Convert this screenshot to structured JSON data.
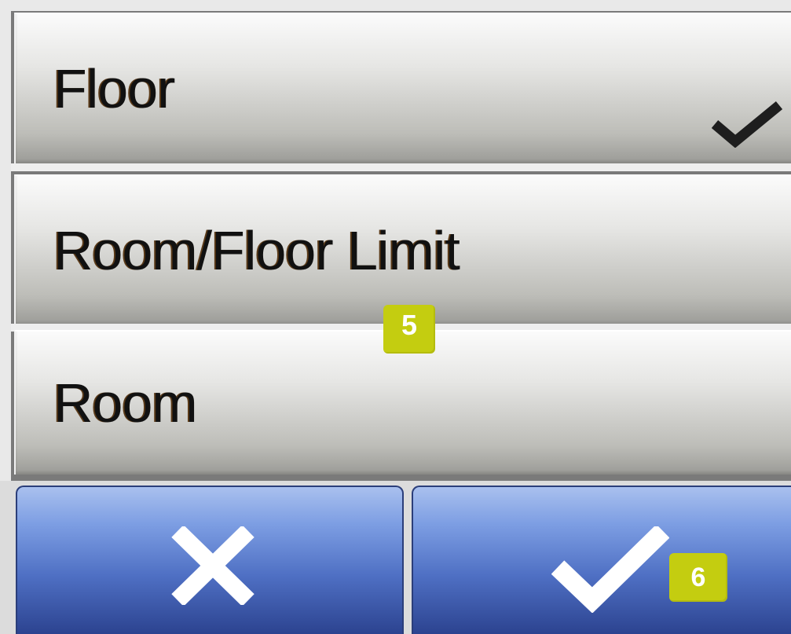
{
  "options": [
    {
      "label": "Floor",
      "selected": true,
      "check_icon": "check-icon"
    },
    {
      "label": "Room/Floor Limit",
      "selected": false
    },
    {
      "label": "Room",
      "selected": false
    }
  ],
  "action_bar": {
    "cancel_icon": "close-icon",
    "confirm_icon": "check-icon"
  },
  "badges": {
    "options_step": "5",
    "confirm_step": "6"
  },
  "colors": {
    "button_blue": "#4f70c4",
    "badge": "#c4cd10",
    "option_gray": "#bdbdb8"
  }
}
